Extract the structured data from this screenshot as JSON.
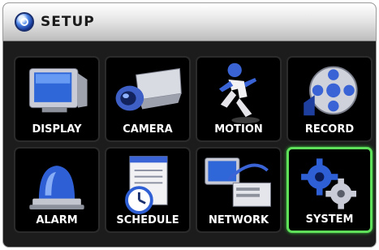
{
  "window": {
    "title": "SETUP"
  },
  "menu": {
    "items": [
      {
        "label": "DISPLAY",
        "icon": "monitor-icon"
      },
      {
        "label": "CAMERA",
        "icon": "camera-icon"
      },
      {
        "label": "MOTION",
        "icon": "running-person-icon"
      },
      {
        "label": "RECORD",
        "icon": "film-reel-icon"
      },
      {
        "label": "ALARM",
        "icon": "alarm-siren-icon"
      },
      {
        "label": "SCHEDULE",
        "icon": "notepad-clock-icon"
      },
      {
        "label": "NETWORK",
        "icon": "network-computer-icon"
      },
      {
        "label": "SYSTEM",
        "icon": "gears-icon"
      }
    ],
    "selected": "SYSTEM"
  },
  "colors": {
    "selection_border": "#5fe05a",
    "background": "#1c1c1c",
    "icon_blue": "#3a64d6"
  }
}
